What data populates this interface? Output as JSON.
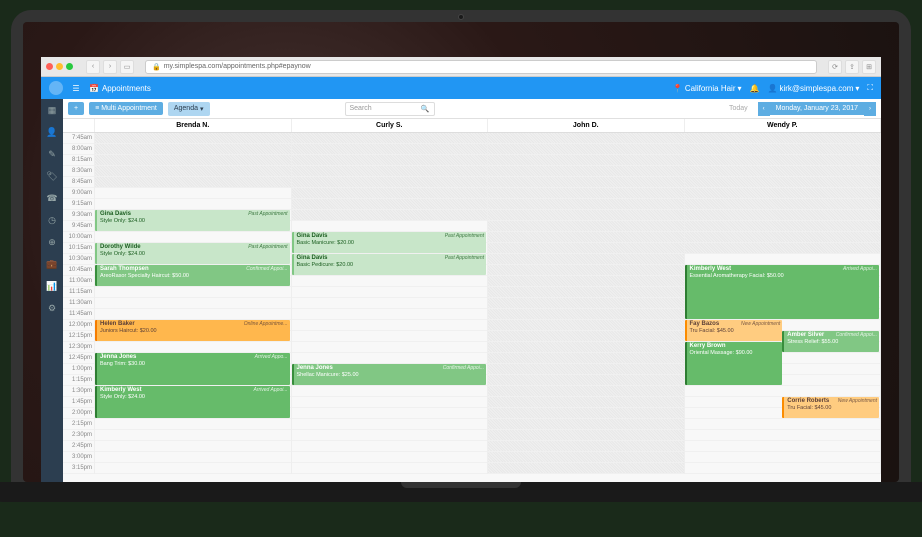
{
  "browser": {
    "url": "my.simplespa.com/appointments.php#epaynow"
  },
  "topbar": {
    "tab": "Appointments",
    "location": "California Hair",
    "user": "kirk@simplespa.com"
  },
  "toolbar": {
    "multi": "Multi Appointment",
    "agenda": "Agenda",
    "search_placeholder": "Search",
    "today": "Today",
    "date": "Monday, January 23, 2017"
  },
  "staff": [
    "Brenda N.",
    "Curly S.",
    "John D.",
    "Wendy P."
  ],
  "time_slots": [
    "7:45am",
    "8:00am",
    "8:15am",
    "8:30am",
    "8:45am",
    "9:00am",
    "9:15am",
    "9:30am",
    "9:45am",
    "10:00am",
    "10:15am",
    "10:30am",
    "10:45am",
    "11:00am",
    "11:15am",
    "11:30am",
    "11:45am",
    "12:00pm",
    "12:15pm",
    "12:30pm",
    "12:45pm",
    "1:00pm",
    "1:15pm",
    "1:30pm",
    "1:45pm",
    "2:00pm",
    "2:15pm",
    "2:30pm",
    "2:45pm",
    "3:00pm",
    "3:15pm"
  ],
  "unavailable_ranges": {
    "0": [
      [
        0,
        5
      ]
    ],
    "1": [
      [
        0,
        8
      ]
    ],
    "2": [
      [
        0,
        31
      ]
    ],
    "3": [
      [
        0,
        11
      ]
    ]
  },
  "appointments": [
    {
      "col": 0,
      "start": 7,
      "span": 2,
      "cls": "past",
      "name": "Gina Davis",
      "svc": "Style Only: $24.00",
      "status": "Past Appointment"
    },
    {
      "col": 0,
      "start": 10,
      "span": 2,
      "cls": "past",
      "name": "Dorothy Wilde",
      "svc": "Style Only: $24.00",
      "status": "Past Appointment"
    },
    {
      "col": 0,
      "start": 12,
      "span": 2,
      "cls": "confirmed",
      "name": "Sarah Thompsen",
      "svc": "AreoRasor Specialty Haircut: $50.00",
      "status": "Confirmed Appoi..."
    },
    {
      "col": 0,
      "start": 17,
      "span": 2,
      "cls": "online",
      "name": "Helen Baker",
      "svc": "Juniors Haircut: $20.00",
      "status": "Online Appointme..."
    },
    {
      "col": 0,
      "start": 20,
      "span": 3,
      "cls": "arrived",
      "name": "Jenna Jones",
      "svc": "Bang Trim: $30.00",
      "status": "Arrived Appo..."
    },
    {
      "col": 0,
      "start": 23,
      "span": 3,
      "cls": "arrived",
      "name": "Kimberly West",
      "svc": "Style Only: $24.00",
      "status": "Arrived Appoi..."
    },
    {
      "col": 1,
      "start": 9,
      "span": 2,
      "cls": "past",
      "name": "Gina Davis",
      "svc": "Basic Manicure: $20.00",
      "status": "Past Appointment"
    },
    {
      "col": 1,
      "start": 11,
      "span": 2,
      "cls": "past",
      "name": "Gina Davis",
      "svc": "Basic Pedicure: $20.00",
      "status": "Past Appointment"
    },
    {
      "col": 1,
      "start": 21,
      "span": 2,
      "cls": "confirmed",
      "name": "Jenna Jones",
      "svc": "Shellac Manicure: $25.00",
      "status": "Confirmed Appoi..."
    },
    {
      "col": 3,
      "start": 12,
      "span": 5,
      "cls": "arrived",
      "name": "Kimberly West",
      "svc": "Essential Aromatherapy Facial: $50.00",
      "status": "Arrived Appoi..."
    },
    {
      "col": 3,
      "start": 17,
      "span": 2,
      "cls": "new",
      "name": "Fay Bazos",
      "svc": "Tru Facial: $45.00",
      "status": "New Appointment",
      "half": "left"
    },
    {
      "col": 3,
      "start": 18,
      "span": 2,
      "cls": "confirmed",
      "name": "Amber Silver",
      "svc": "Stress Relief: $55.00",
      "status": "Confirmed Appoi...",
      "half": "right"
    },
    {
      "col": 3,
      "start": 19,
      "span": 4,
      "cls": "arrived",
      "name": "Kerry Brown",
      "svc": "Oriental Massage: $90.00",
      "status": "",
      "half": "left"
    },
    {
      "col": 3,
      "start": 24,
      "span": 2,
      "cls": "new",
      "name": "Corrie Roberts",
      "svc": "Tru Facial: $45.00",
      "status": "New Appointment",
      "half": "right"
    }
  ]
}
